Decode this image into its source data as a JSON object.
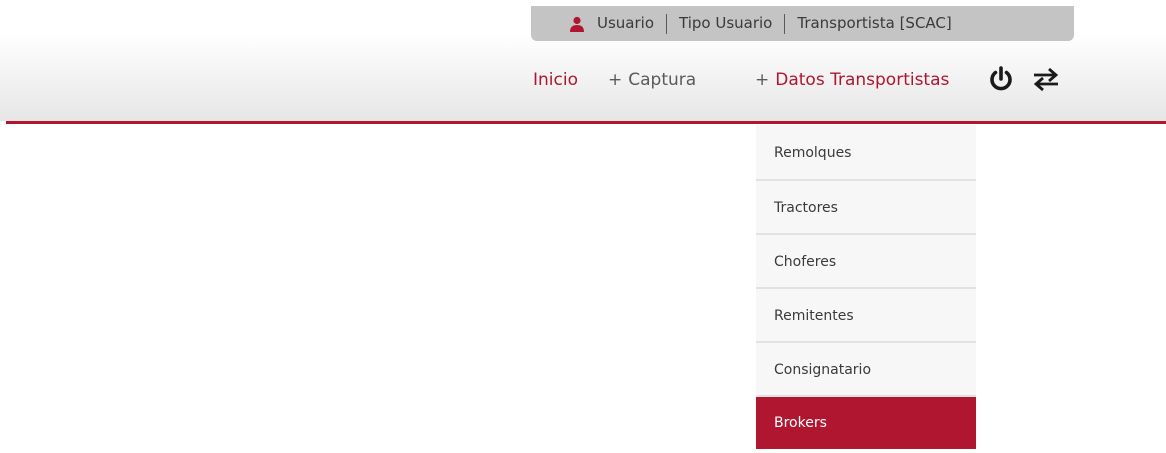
{
  "userbar": {
    "user_icon": "user-icon",
    "usuario": "Usuario",
    "tipo_usuario": "Tipo Usuario",
    "transportista": "Transportista [SCAC]"
  },
  "nav": {
    "inicio": "Inicio",
    "captura": "Captura",
    "datos": "Datos Transportistas",
    "plus": "+",
    "power_icon": "power-icon",
    "swap_icon": "swap-arrows-icon"
  },
  "dropdown": {
    "items": [
      {
        "label": "Remolques"
      },
      {
        "label": "Tractores"
      },
      {
        "label": "Choferes"
      },
      {
        "label": "Remitentes"
      },
      {
        "label": "Consignatario"
      },
      {
        "label": "Brokers"
      }
    ],
    "active_index": 5
  },
  "colors": {
    "accent": "#b0162f",
    "userbar_bg": "#c4c4c4",
    "text": "#3a3a3a",
    "dropdown_bg": "#f7f7f7"
  }
}
